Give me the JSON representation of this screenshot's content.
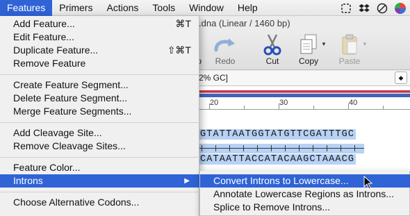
{
  "menubar": {
    "items": [
      "Features",
      "Primers",
      "Actions",
      "Tools",
      "Window",
      "Help"
    ],
    "active": "Features"
  },
  "status_icons": [
    "clipboard-icon",
    "dropbox-icon",
    "do-not-disturb-icon",
    "color-wheel-icon"
  ],
  "window": {
    "title": ".dna  (Linear / 1460 bp)",
    "gc_text": "2% GC]"
  },
  "toolbar": {
    "partial_label": "o",
    "redo_label": "Redo",
    "cut_label": "Cut",
    "copy_label": "Copy",
    "paste_label": "Paste"
  },
  "ruler": {
    "ticks": [
      "20",
      "30",
      "40"
    ]
  },
  "sequence": {
    "top_strand": "GTATTAATGGTATGTTCGATTTGC",
    "bottom_strand": "CATAATTACCATACAAGCTAAACG"
  },
  "features_menu": {
    "add_feature": "Add Feature...",
    "add_feature_shortcut": "⌘T",
    "edit_feature": "Edit Feature...",
    "duplicate_feature": "Duplicate Feature...",
    "duplicate_feature_shortcut": "⇧⌘T",
    "remove_feature": "Remove Feature",
    "create_segment": "Create Feature Segment...",
    "delete_segment": "Delete Feature Segment...",
    "merge_segments": "Merge Feature Segments...",
    "add_cleavage": "Add Cleavage Site...",
    "remove_cleavage": "Remove Cleavage Sites...",
    "feature_color": "Feature Color...",
    "introns": "Introns",
    "choose_codons": "Choose Alternative Codons..."
  },
  "introns_submenu": {
    "convert": "Convert Introns to Lowercase...",
    "annotate": "Annotate Lowercase Regions as Introns...",
    "splice": "Splice to Remove Introns..."
  },
  "colors": {
    "accent": "#2f63d6",
    "selection": "#b7d2f4"
  }
}
